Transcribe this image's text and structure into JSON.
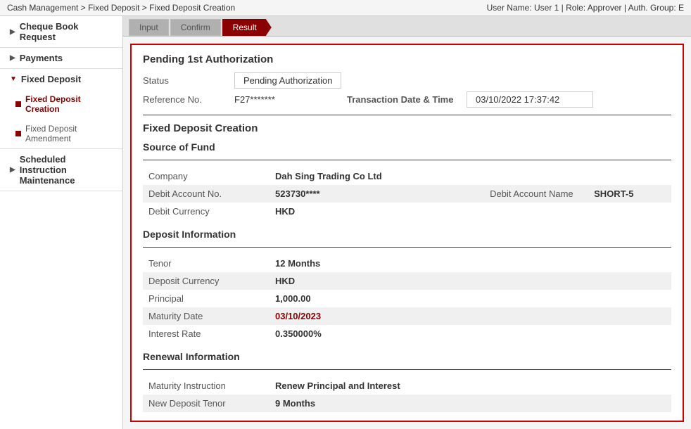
{
  "topbar": {
    "breadcrumb": "Cash Management > Fixed Deposit > Fixed Deposit Creation",
    "user_info": "User Name: User 1    | Role: Approver | Auth. Group: E"
  },
  "tabs": [
    {
      "label": "Input",
      "state": "inactive"
    },
    {
      "label": "Confirm",
      "state": "inactive"
    },
    {
      "label": "Result",
      "state": "active"
    }
  ],
  "sidebar": {
    "items": [
      {
        "label": "Cheque Book Request",
        "type": "parent",
        "arrow": "▶"
      },
      {
        "label": "Payments",
        "type": "parent",
        "arrow": "▶"
      },
      {
        "label": "Fixed Deposit",
        "type": "parent-open",
        "arrow": "▼"
      },
      {
        "label": "Fixed Deposit Creation",
        "type": "sub-active"
      },
      {
        "label": "Fixed Deposit Amendment",
        "type": "sub"
      },
      {
        "label": "Scheduled Instruction Maintenance",
        "type": "parent",
        "arrow": "▶"
      }
    ]
  },
  "result": {
    "panel_title": "Pending 1st Authorization",
    "status_label": "Status",
    "status_value": "Pending Authorization",
    "ref_label": "Reference No.",
    "ref_value": "F27*******",
    "txn_label": "Transaction Date & Time",
    "txn_value": "03/10/2022 17:37:42",
    "fd_creation_title": "Fixed Deposit Creation",
    "source_of_fund_title": "Source of Fund",
    "source_rows": [
      {
        "label": "Company",
        "value": "Dah Sing Trading Co Ltd",
        "label2": "",
        "value2": ""
      },
      {
        "label": "Debit Account No.",
        "value": "523730****",
        "label2": "Debit Account Name",
        "value2": "SHORT-5"
      },
      {
        "label": "Debit Currency",
        "value": "HKD",
        "label2": "",
        "value2": ""
      }
    ],
    "deposit_info_title": "Deposit Information",
    "deposit_rows": [
      {
        "label": "Tenor",
        "value": "12 Months",
        "is_date": false
      },
      {
        "label": "Deposit Currency",
        "value": "HKD",
        "is_date": false
      },
      {
        "label": "Principal",
        "value": "1,000.00",
        "is_date": false
      },
      {
        "label": "Maturity Date",
        "value": "03/10/2023",
        "is_date": true
      },
      {
        "label": "Interest Rate",
        "value": "0.350000%",
        "is_date": false
      }
    ],
    "renewal_info_title": "Renewal Information",
    "renewal_rows": [
      {
        "label": "Maturity Instruction",
        "value": "Renew Principal and Interest",
        "is_date": false
      },
      {
        "label": "New Deposit Tenor",
        "value": "9 Months",
        "is_date": false
      }
    ]
  }
}
